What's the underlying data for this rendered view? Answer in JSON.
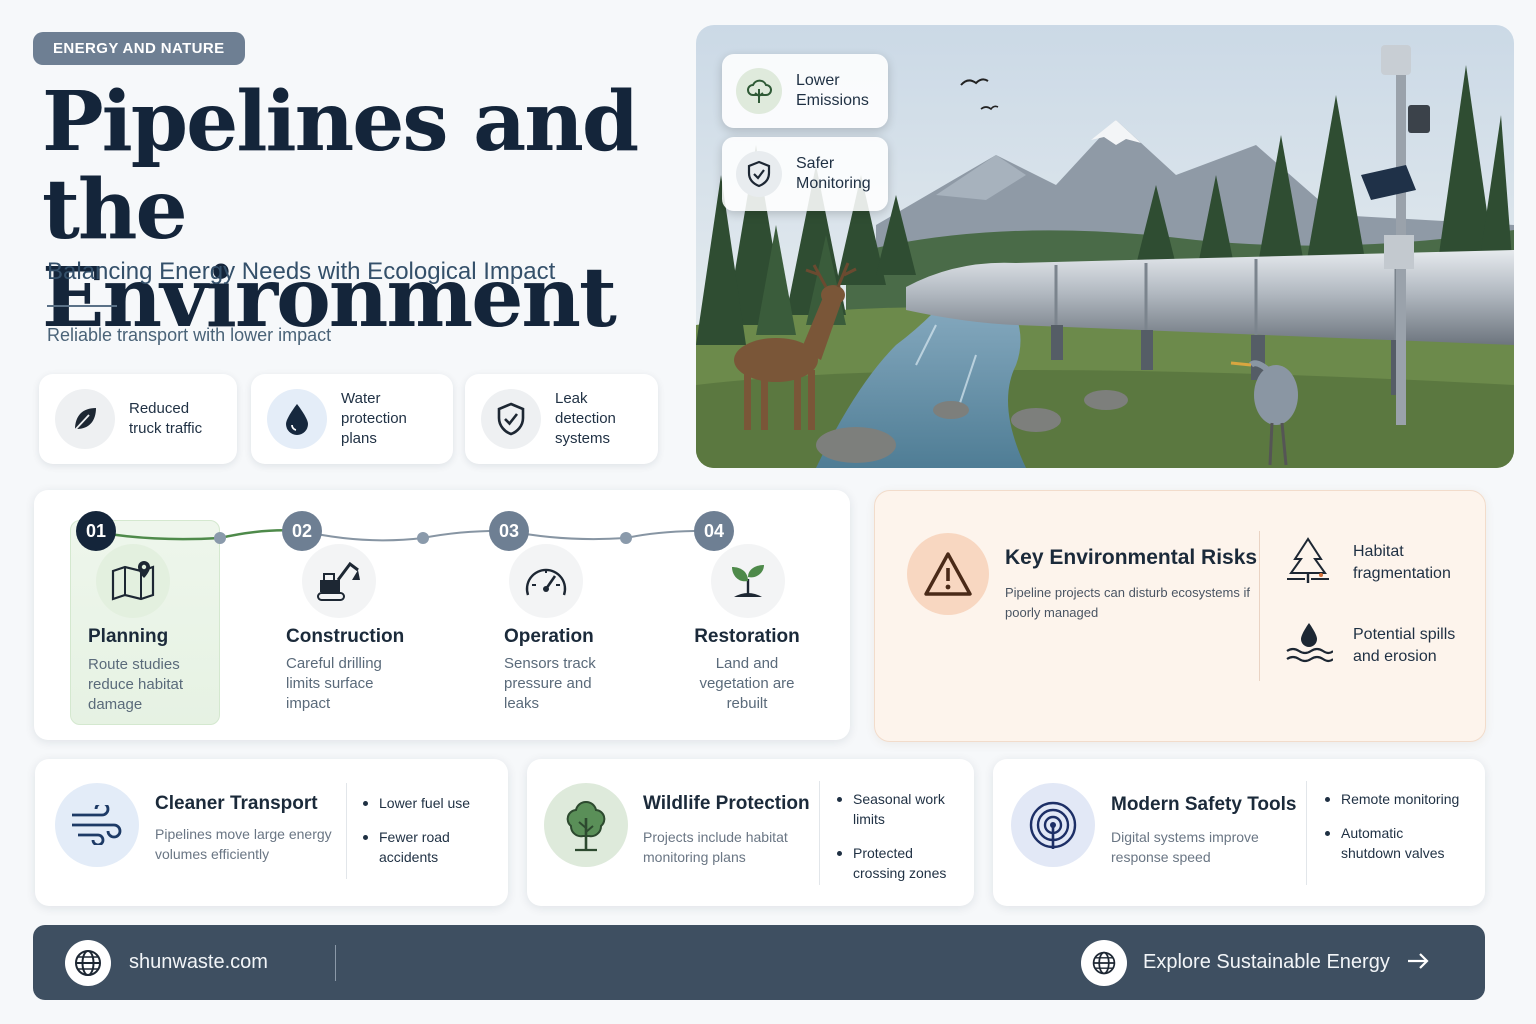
{
  "header": {
    "tag": "ENERGY AND NATURE",
    "title_line1": "Pipelines and",
    "title_line2": "the Environment",
    "subtitle": "Balancing Energy Needs with Ecological Impact",
    "tagline": "Reliable transport with lower impact"
  },
  "features": [
    {
      "label": "Reduced truck traffic",
      "icon": "leaf-icon"
    },
    {
      "label": "Water protection plans",
      "icon": "water-drop-icon"
    },
    {
      "label": "Leak detection systems",
      "icon": "shield-check-icon"
    }
  ],
  "hero": {
    "badges": [
      {
        "label": "Lower Emissions",
        "icon": "tree-cloud-icon"
      },
      {
        "label": "Safer Monitoring",
        "icon": "shield-check-icon"
      }
    ]
  },
  "steps": [
    {
      "num": "01",
      "title": "Planning",
      "desc": "Route studies reduce habitat damage",
      "icon": "map-pin-icon"
    },
    {
      "num": "02",
      "title": "Construction",
      "desc": "Careful drilling limits surface impact",
      "icon": "excavator-icon"
    },
    {
      "num": "03",
      "title": "Operation",
      "desc": "Sensors track pressure and leaks",
      "icon": "gauge-icon"
    },
    {
      "num": "04",
      "title": "Restoration",
      "desc": "Land and vegetation are rebuilt",
      "icon": "sprout-icon"
    }
  ],
  "risks": {
    "title": "Key Environmental Risks",
    "desc": "Pipeline projects can disturb ecosystems if poorly managed",
    "items": [
      {
        "label": "Habitat fragmentation",
        "icon": "tree-split-icon"
      },
      {
        "label": "Potential spills and erosion",
        "icon": "drop-waves-icon"
      }
    ]
  },
  "cards": [
    {
      "title": "Cleaner Transport",
      "desc": "Pipelines move large energy volumes efficiently",
      "bullets": [
        "Lower fuel use",
        "Fewer road accidents"
      ],
      "icon": "wind-icon"
    },
    {
      "title": "Wildlife Protection",
      "desc": "Projects include habitat monitoring plans",
      "bullets": [
        "Seasonal work limits",
        "Protected crossing zones"
      ],
      "icon": "tree-icon"
    },
    {
      "title": "Modern Safety Tools",
      "desc": "Digital systems improve response speed",
      "bullets": [
        "Remote monitoring",
        "Automatic shutdown valves"
      ],
      "icon": "signal-icon"
    }
  ],
  "footer": {
    "site": "shunwaste.com",
    "cta": "Explore Sustainable Energy"
  },
  "colors": {
    "navy": "#14253a",
    "green": "#4e8a4a",
    "slate": "#6e7f93",
    "risk_orange": "#f8d7c1",
    "footer": "#3e4f61"
  }
}
